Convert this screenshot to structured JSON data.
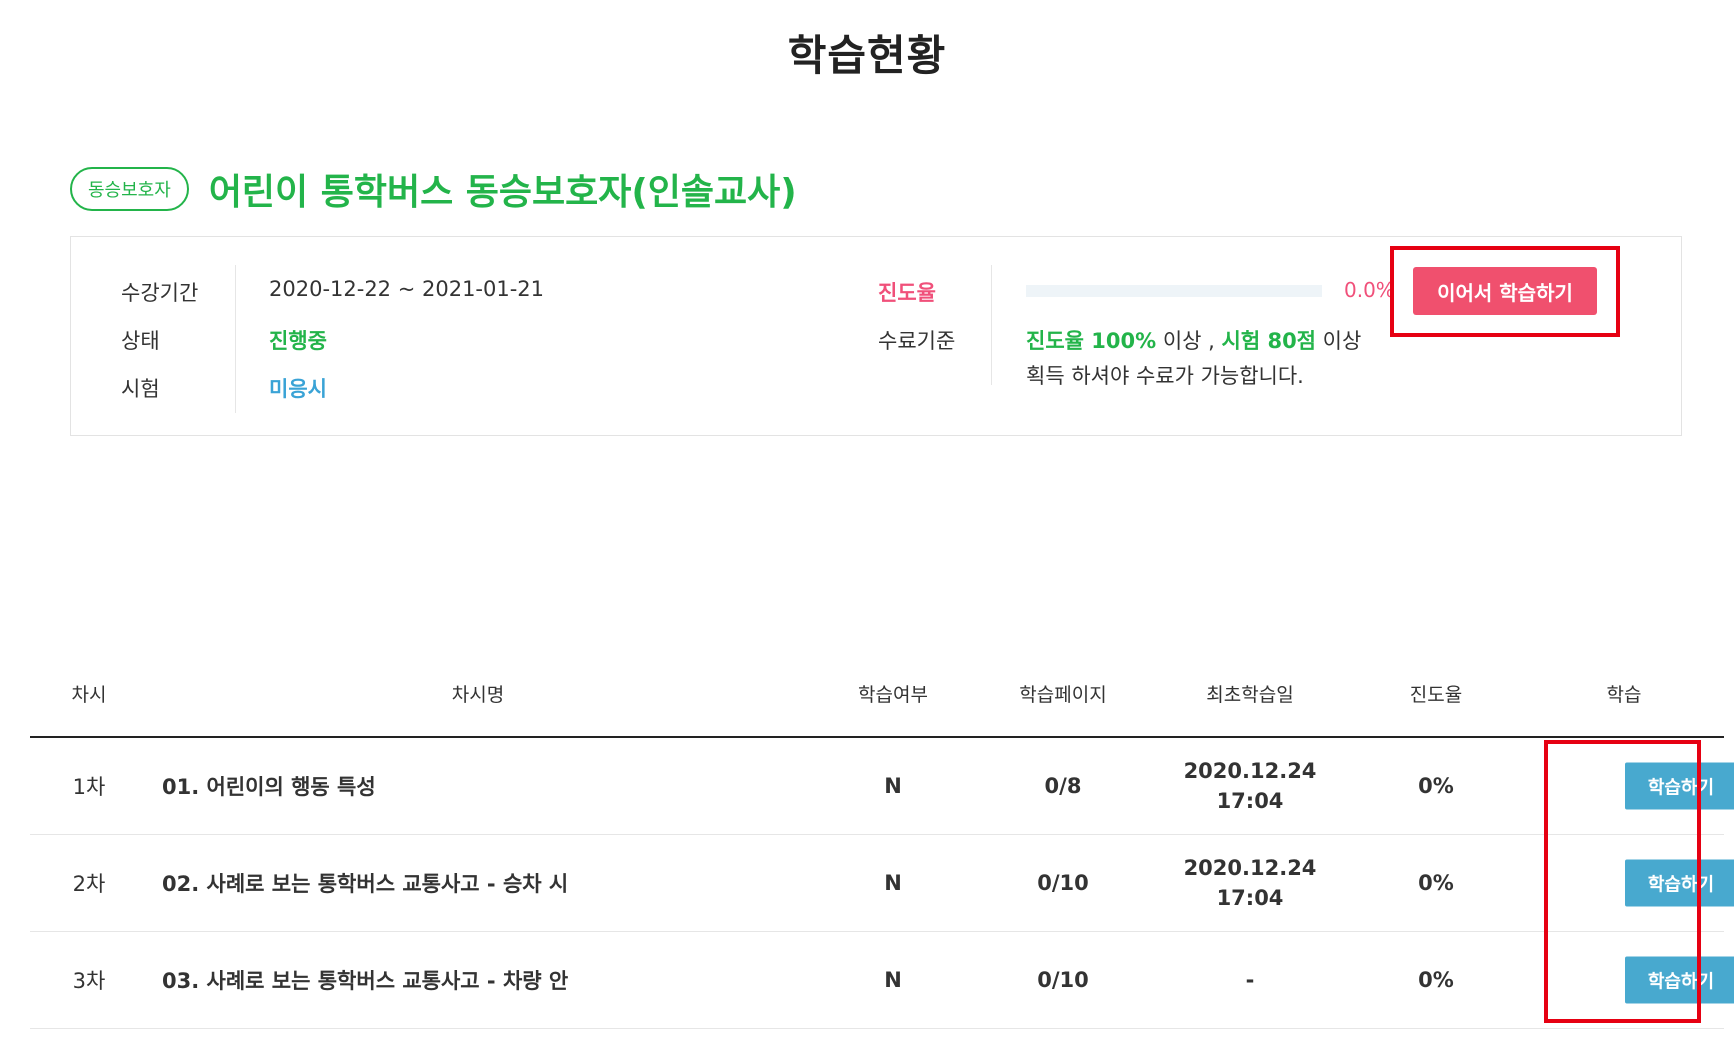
{
  "page_title": "학습현황",
  "course": {
    "badge": "동승보호자",
    "title": "어린이 통학버스 동승보호자(인솔교사)"
  },
  "info": {
    "period_label": "수강기간",
    "period_value": "2020-12-22 ~ 2021-01-21",
    "status_label": "상태",
    "status_value": "진행중",
    "exam_label": "시험",
    "exam_value": "미응시",
    "progress_label": "진도율",
    "progress_value": "0.0%",
    "progress_fraction": 0.0,
    "criteria_label": "수료기준",
    "criteria_part1": "진도율 100%",
    "criteria_part2": " 이상 , ",
    "criteria_part3": "시험 80점",
    "criteria_part4": " 이상",
    "criteria_line2": "획득 하셔야 수료가 가능합니다.",
    "continue_button": "이어서 학습하기"
  },
  "table": {
    "headers": {
      "session": "차시",
      "name": "차시명",
      "studied": "학습여부",
      "pages": "학습페이지",
      "first_date": "최초학습일",
      "progress": "진도율",
      "action": "학습"
    },
    "rows": [
      {
        "session": "1차",
        "name": "01. 어린이의 행동 특성",
        "studied": "N",
        "pages": "0/8",
        "first_date": "2020.12.24",
        "first_time": "17:04",
        "progress": "0%",
        "button": "학습하기"
      },
      {
        "session": "2차",
        "name": "02. 사례로 보는 통학버스 교통사고 - 승차 시",
        "studied": "N",
        "pages": "0/10",
        "first_date": "2020.12.24",
        "first_time": "17:04",
        "progress": "0%",
        "button": "학습하기"
      },
      {
        "session": "3차",
        "name": "03. 사례로 보는 통학버스 교통사고 - 차량 안",
        "studied": "N",
        "pages": "0/10",
        "first_date": "-",
        "first_time": "",
        "progress": "0%",
        "button": "학습하기"
      }
    ]
  },
  "colors": {
    "accent_green": "#23b44a",
    "accent_pink": "#f0507a",
    "button_blue": "#48a9cf",
    "highlight_red": "#e60012"
  }
}
